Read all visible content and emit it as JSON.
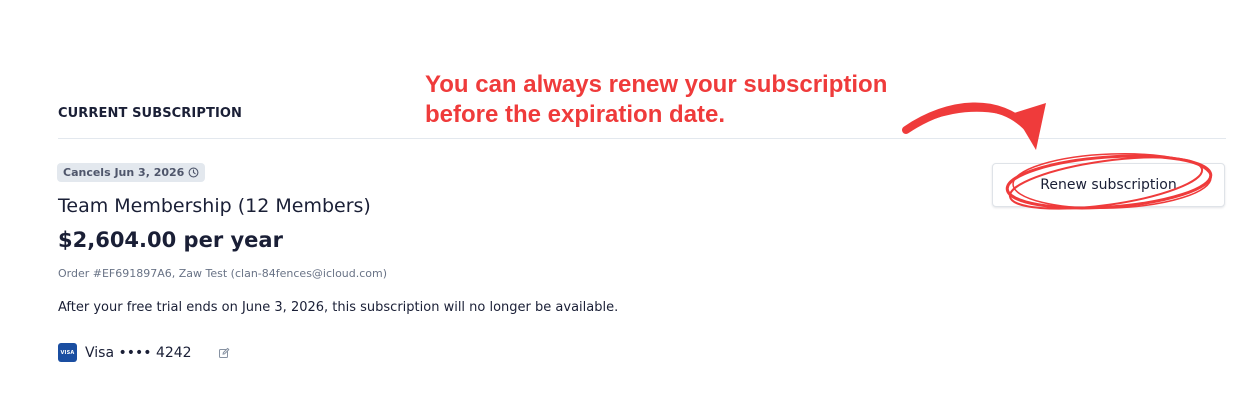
{
  "annotation": {
    "line1": "You can always renew your subscription",
    "line2": "before the expiration date.",
    "color": "#ef3b3b"
  },
  "section": {
    "title": "CURRENT SUBSCRIPTION"
  },
  "subscription": {
    "status_badge": "Cancels Jun 3, 2026",
    "status_icon": "clock-icon",
    "plan_name": "Team Membership (12 Members)",
    "price": "$2,604.00 per year",
    "order_info": "Order #EF691897A6, Zaw Test (clan-84fences@icloud.com)",
    "trial_note": "After your free trial ends on June 3, 2026, this subscription will no longer be available."
  },
  "payment": {
    "brand_logo": "VISA",
    "card_label": "Visa •••• 4242",
    "edit_icon": "pencil-edit-icon"
  },
  "actions": {
    "renew_label": "Renew subscription"
  },
  "colors": {
    "accent_red": "#ef3b3b",
    "visa_blue": "#1a4ea1",
    "text_primary": "#1a1f36",
    "text_muted": "#697386",
    "badge_bg": "#e3e8ee"
  }
}
